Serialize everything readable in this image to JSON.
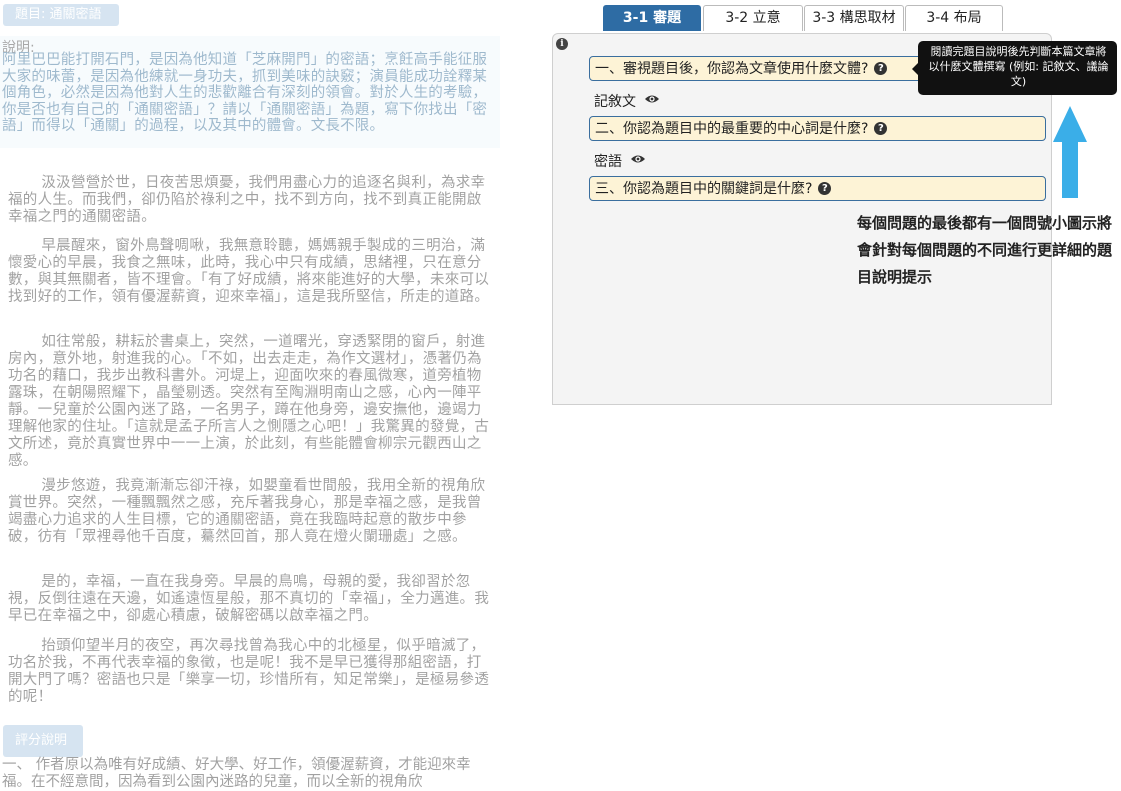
{
  "left": {
    "topic_chip": "題目: 通關密語",
    "description_label": "說明:",
    "description": "阿里巴巴能打開石門，是因為他知道「芝麻開門」的密語；烹飪高手能征服大家的味蕾，是因為他練就一身功夫，抓到美味的訣竅；演員能成功詮釋某個角色，必然是因為他對人生的悲歡離合有深刻的領會。對於人生的考驗，你是否也有自己的「通關密語」？請以「通關密語」為題，寫下你找出「密語」而得以「通關」的過程，以及其中的體會。文長不限。",
    "essay": [
      "汲汲營營於世，日夜苦思煩憂，我們用盡心力的追逐名與利，為求幸福的人生。而我們，卻仍陷於祿利之中，找不到方向，找不到真正能開啟幸福之門的通關密語。",
      "早晨醒來，窗外鳥聲啁啾，我無意聆聽，媽媽親手製成的三明治，滿懷愛心的早晨，我食之無味，此時，我心中只有成績，思緒裡，只在意分數，與其無關者，皆不理會。「有了好成績，將來能進好的大學，未來可以找到好的工作，領有優渥薪資，迎來幸福」，這是我所堅信，所走的道路。",
      "如往常般，耕耘於書桌上，突然，一道曙光，穿透緊閉的窗戶，射進房內，意外地，射進我的心。「不如，出去走走，為作文選材」，憑著仍為功名的藉口，我步出教科書外。河堤上，迎面吹來的春風微寒，道旁植物露珠，在朝陽照耀下，晶瑩剔透。突然有至陶淵明南山之感，心內一陣平靜。一兒童於公園內迷了路，一名男子，蹲在他身旁，邊安撫他，邊竭力理解他家的住址。「這就是孟子所言人之惻隱之心吧！」我驚異的發覺，古文所述，竟於真實世界中一一上演，於此刻，有些能體會柳宗元觀西山之感。",
      "漫步悠遊，我竟漸漸忘卻汗祿，如嬰童看世間般，我用全新的視角欣賞世界。突然，一種飄飄然之感，充斥著我身心，那是幸福之感，是我曾竭盡心力追求的人生目標，它的通關密語，竟在我臨時起意的散步中參破，彷有「眾裡尋他千百度，驀然回首，那人竟在燈火闌珊處」之感。",
      "是的，幸福，一直在我身旁。早晨的鳥鳴，母親的愛，我卻習於忽視，反倒往遠在天邊，如遙遠恆星般，那不真切的「幸福」，全力邁進。我早已在幸福之中，卻處心積慮，破解密碼以啟幸福之門。",
      "抬頭仰望半月的夜空，再次尋找曾為我心中的北極星，似乎暗滅了，功名於我，不再代表幸福的象徵，也是呢！我不是早已獲得那組密語，打開大門了嗎？密語也只是「樂享一切，珍惜所有，知足常樂」，是極易參透的呢！"
    ],
    "score_chip": "評分說明",
    "score_text": "一、 作者原以為唯有好成績、好大學、好工作，領優渥薪資，才能迎來幸福。在不經意間，因為看到公園內迷路的兒童，而以全新的視角欣"
  },
  "tabs": [
    {
      "label": "3-1 審題",
      "active": true
    },
    {
      "label": "3-2 立意",
      "active": false
    },
    {
      "label": "3-3 構思取材",
      "active": false
    },
    {
      "label": "3-4 布局",
      "active": false
    }
  ],
  "panel": {
    "info_icon": "i",
    "questions": [
      {
        "text": "一、審視題目後，你認為文章使用什麼文體?",
        "answer": "記敘文"
      },
      {
        "text": "二、你認為題目中的最重要的中心詞是什麼?",
        "answer": "密語"
      },
      {
        "text": "三、你認為題目中的關鍵詞是什麼?",
        "answer": ""
      }
    ],
    "help_icon": "?"
  },
  "tooltip": {
    "text": "閱讀完題目說明後先判斷本篇文章將以什麼文體撰寫 (例如: 記敘文、議論文)"
  },
  "annotation": {
    "note": "每個問題的最後都有一個問號小圖示將會針對每個問題的不同進行更詳細的題目說明提示",
    "arrow_color": "#3aaee8"
  },
  "colors": {
    "tab_active": "#2e6ca4",
    "question_bg": "#fdf3d6",
    "question_border": "#3a6e9e",
    "chip": "#9ec1de"
  }
}
